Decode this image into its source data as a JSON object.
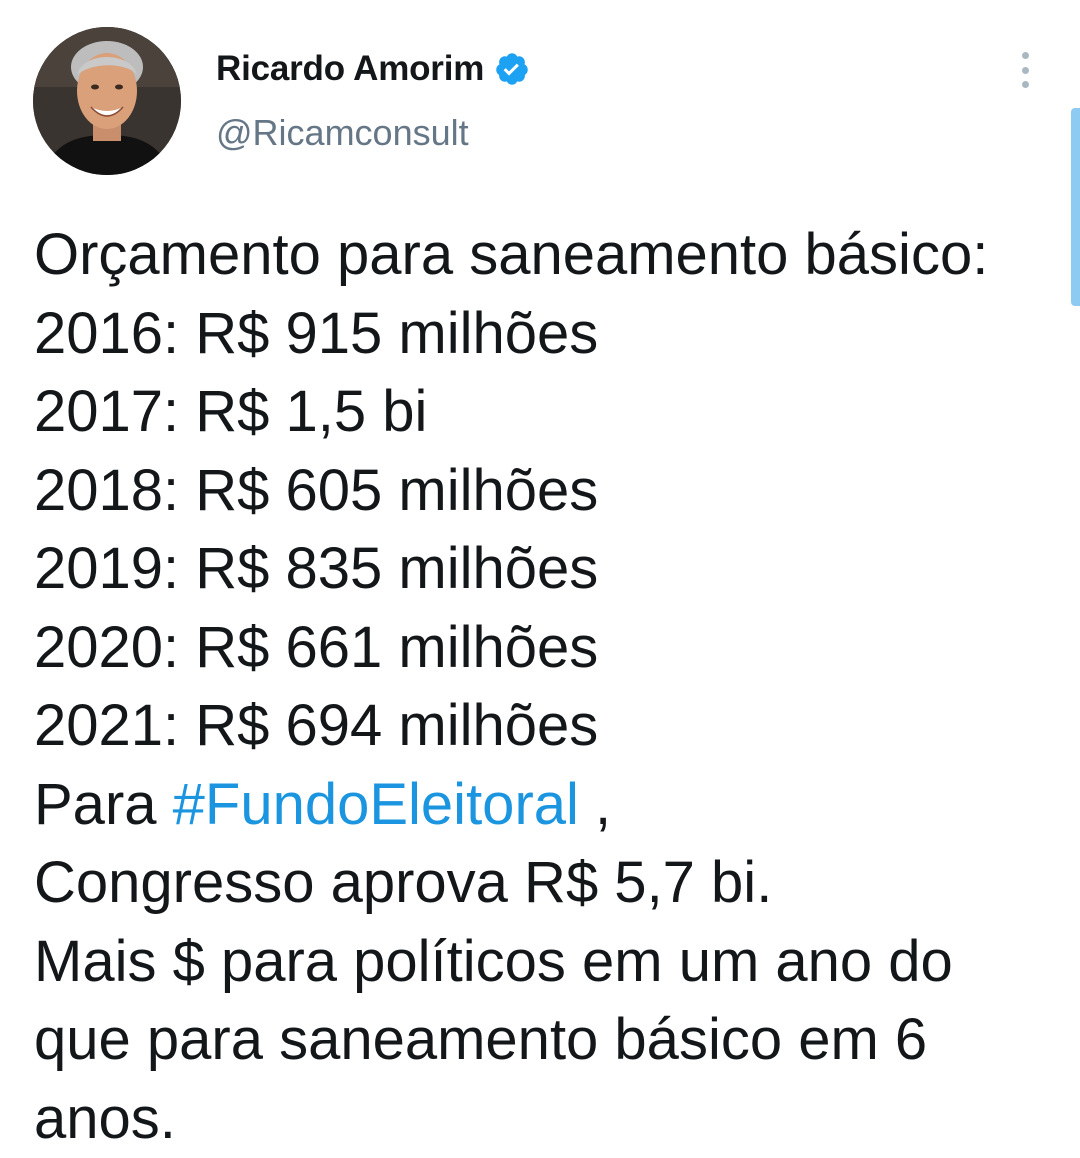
{
  "author": {
    "display_name": "Ricardo Amorim",
    "handle": "@Ricamconsult",
    "verified": true
  },
  "icons": {
    "verified": "verified-badge-icon",
    "more": "more-vertical-icon"
  },
  "colors": {
    "link": "#1b95e0",
    "verified": "#1da1f2",
    "secondary_text": "#657786",
    "scroll_indicator": "#8ecbf3"
  },
  "tweet": {
    "lines": [
      "Orçamento para saneamento básico:",
      "2016: R$ 915 milhões",
      "2017: R$ 1,5 bi",
      "2018: R$ 605 milhões",
      "2019: R$ 835 milhões",
      "2020: R$ 661 milhões",
      "2021: R$ 694 milhões"
    ],
    "hashtag_prefix": "Para ",
    "hashtag": "#FundoEleitoral",
    "hashtag_suffix": " ,",
    "closing_lines": [
      "Congresso aprova R$ 5,7 bi.",
      "Mais $ para políticos em um ano do",
      "que para saneamento básico em 6",
      "anos."
    ]
  }
}
